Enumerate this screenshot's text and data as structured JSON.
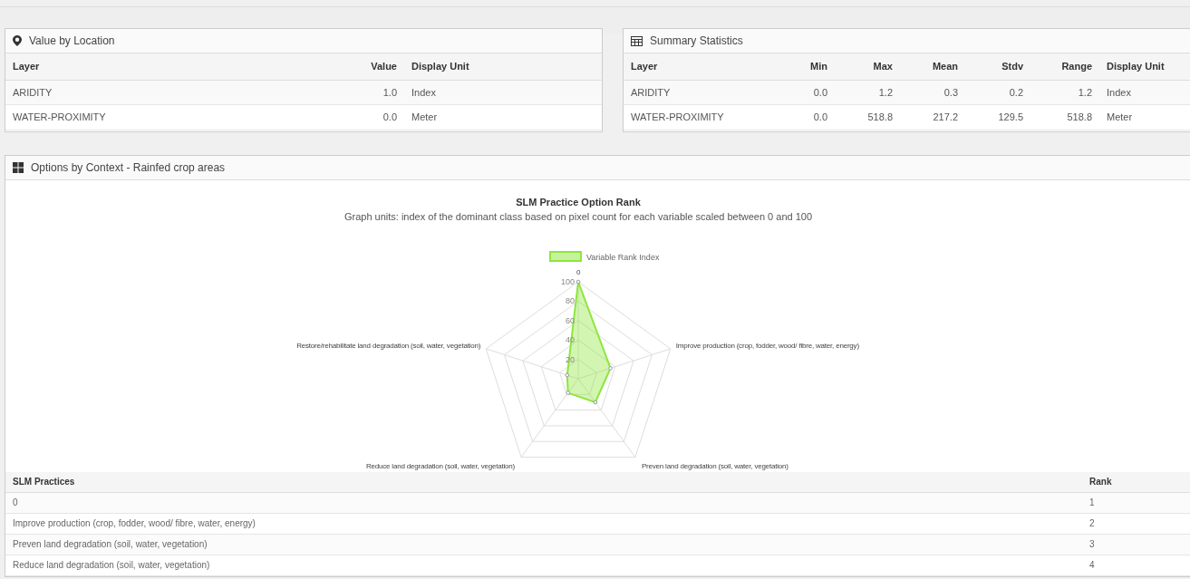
{
  "location_panel": {
    "title": "Value by Location",
    "columns": [
      "Layer",
      "Value",
      "Display Unit"
    ],
    "rows": [
      [
        "ARIDITY",
        "1.0",
        "Index"
      ],
      [
        "WATER-PROXIMITY",
        "0.0",
        "Meter"
      ]
    ]
  },
  "stats_panel": {
    "title": "Summary Statistics",
    "columns": [
      "Layer",
      "Min",
      "Max",
      "Mean",
      "Stdv",
      "Range",
      "Display Unit"
    ],
    "rows": [
      [
        "ARIDITY",
        "0.0",
        "1.2",
        "0.3",
        "0.2",
        "1.2",
        "Index"
      ],
      [
        "WATER-PROXIMITY",
        "0.0",
        "518.8",
        "217.2",
        "129.5",
        "518.8",
        "Meter"
      ]
    ]
  },
  "options_panel": {
    "title": "Options by Context - Rainfed crop areas",
    "radar_chart": {
      "title": "SLM Practice Option Rank",
      "subtitle": "Graph units: index of the dominant class based on pixel count for each variable scaled between 0 and 100",
      "axis_labels": [
        "0",
        "Restore/rehabilitate land degradation (soil, water, vegetation)",
        "Improve production (crop, fodder, wood/ fibre, water, energy)",
        "Reduce land degradation (soil, water, vegetation)",
        "Preven land degradation (soil, water, vegetation)"
      ],
      "legend": "Variable Rank Index",
      "tick_labels": [
        "100",
        "80",
        "60",
        "40",
        "20"
      ]
    },
    "table": {
      "columns": [
        "SLM Practices",
        "Rank"
      ],
      "rows": [
        [
          "0",
          "1"
        ],
        [
          "Improve production (crop, fodder, wood/ fibre, water, energy)",
          "2"
        ],
        [
          "Preven land degradation (soil, water, vegetation)",
          "3"
        ],
        [
          "Reduce land degradation (soil, water, vegetation)",
          "4"
        ]
      ]
    }
  }
}
